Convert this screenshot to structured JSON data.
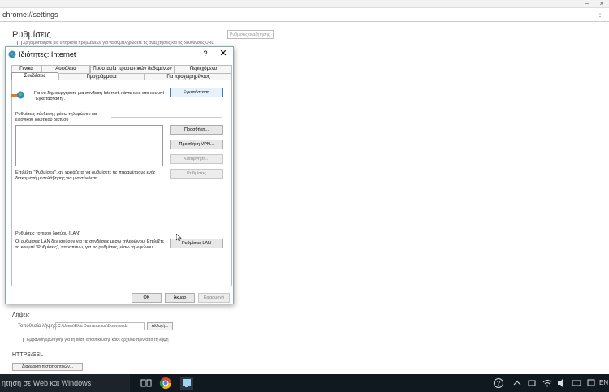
{
  "browser": {
    "url": "chrome://settings",
    "menu_icon": "menu-icon",
    "minimize_label": "−",
    "close_label": "×"
  },
  "settings": {
    "title": "Ρυθμίσεις",
    "search_placeholder": "Ρυθμίσεις αναζήτησης",
    "privacy_line": "Χρησιμοποιήστε μια υπηρεσία προβλέψεων για να συμπληρώσετε τις αναζητήσεις και τις διευθύνσεις URL",
    "downloads": {
      "heading": "Λήψεις",
      "location_label": "Τοποθεσία λήψης:",
      "location_value": "C:\\Users\\Ελιά Dumanumus\\Downloads",
      "change_label": "Αλλαγή...",
      "ask_label": "Εμφάνιση ερώτησης για τη θέση αποθήκευσης κάθε αρχείου πριν από τη λήψη"
    },
    "ssl": {
      "heading": "HTTPS/SSL",
      "manage_label": "Διαχείριση πιστοποιητικών..."
    }
  },
  "dialog": {
    "title": "Ιδιότητες: Internet",
    "help_label": "?",
    "close_label": "✕",
    "tabs_row1": [
      "Γενικά",
      "Ασφάλεια",
      "Προστασία προσωπικών δεδομένων",
      "Περιεχόμενο"
    ],
    "tabs_row2": [
      "Συνδέσεις",
      "Προγράμματα",
      "Για προχωρημένους"
    ],
    "intro_text": "Για να δημιουργήσετε μια σύνδεση Internet, κάντε κλικ στο κουμπί \"Εγκατάσταση\".",
    "setup_label": "Εγκατάσταση",
    "dialup_heading": "Ρυθμίσεις σύνδεσης μέσω τηλεφώνου και εικονικού ιδιωτικού δικτύου",
    "add_label": "Προσθήκη...",
    "add_vpn_label": "Προσθήκη VPN...",
    "remove_label": "Κατάργηση...",
    "settings_label": "Ρυθμίσεις",
    "dialup_desc": "Επιλέξτε \"Ρυθμίσεις\", αν χρειάζεται να ρυθμίσετε τις παραμέτρους ενός διακομιστή μεσολάβησης για μια σύνδεση.",
    "lan_heading": "Ρυθμίσεις τοπικού δικτύου (LAN)",
    "lan_desc": "Οι ρυθμίσεις LAN δεν ισχύουν για τις συνδέσεις μέσω τηλεφώνου. Επιλέξτε το κουμπί \"Ρυθμίσεις\", παραπάνω, για τις ρυθμίσεις μέσω τηλεφώνου.",
    "lan_settings_label": "Ρυθμίσεις LAN",
    "ok_label": "OK",
    "cancel_label": "Άκυρο",
    "apply_label": "Εφαρμογή"
  },
  "taskbar": {
    "search_text": "ητηση σε Web και Windows",
    "lang": "EN"
  }
}
